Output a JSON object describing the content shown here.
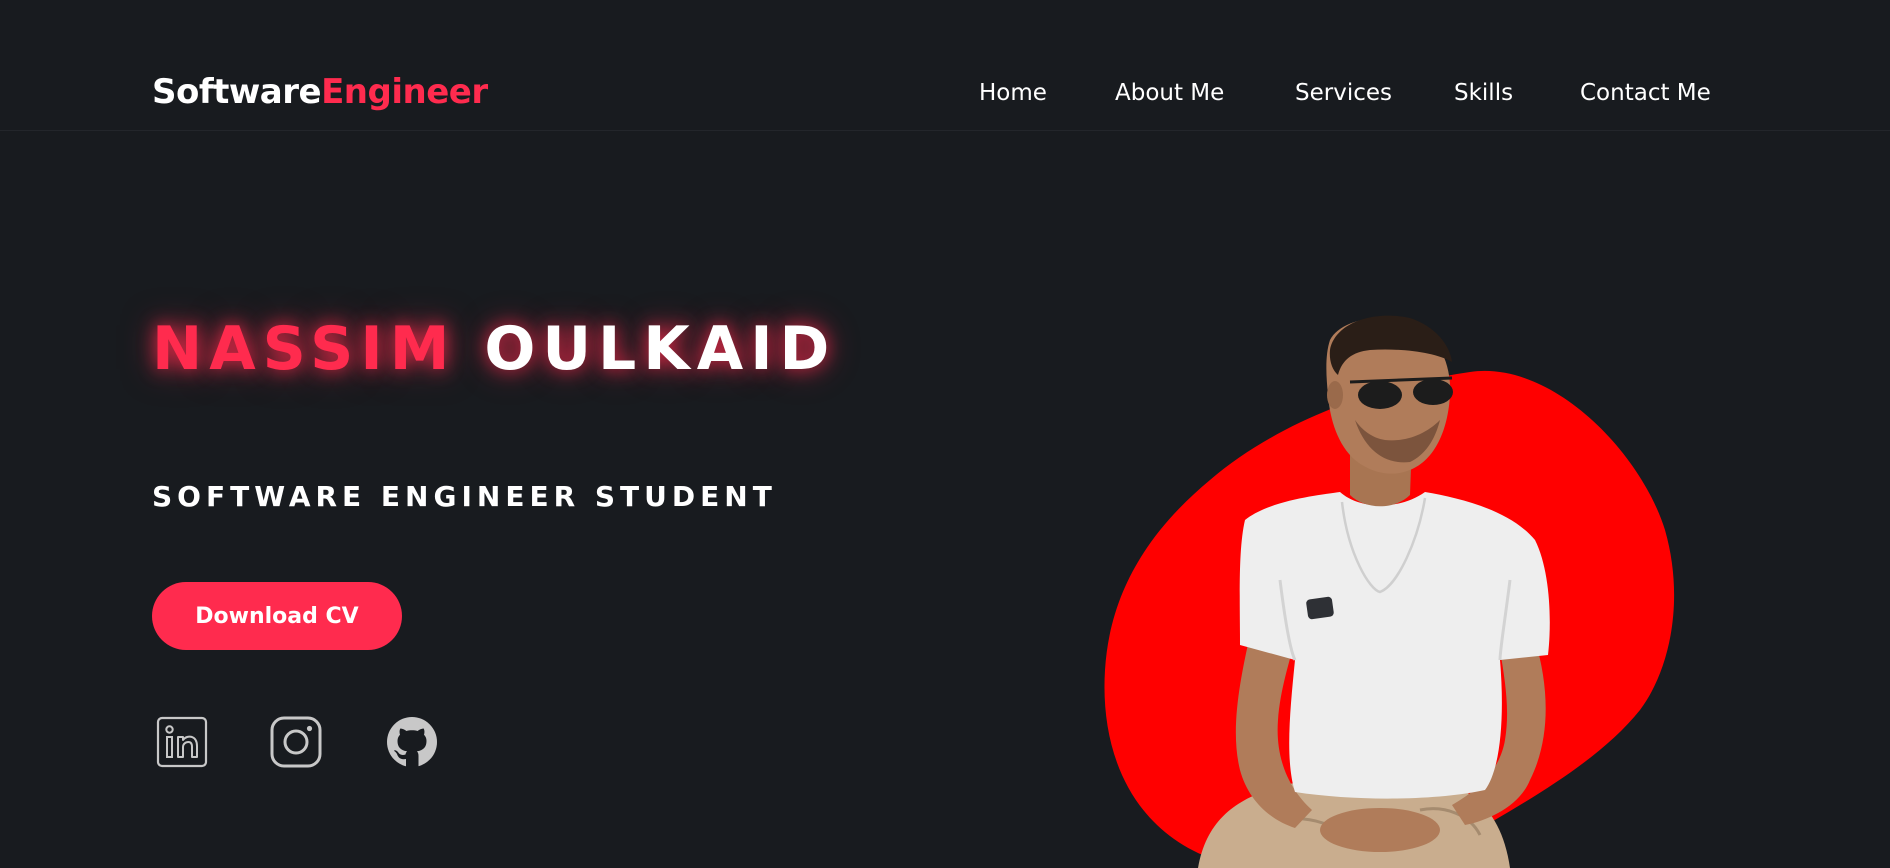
{
  "logo": {
    "part1": "Software",
    "part2": "Engineer"
  },
  "nav": {
    "items": [
      "Home",
      "About Me",
      "Services",
      "Skills",
      "Contact Me"
    ]
  },
  "hero": {
    "first_name": "NASSIM",
    "last_name": "OULKAID",
    "subtitle": "SOFTWARE ENGINEER STUDENT",
    "cta_label": "Download CV"
  },
  "social": {
    "icons": [
      "linkedin-icon",
      "instagram-icon",
      "github-icon"
    ]
  },
  "colors": {
    "background": "#181b1f",
    "accent": "#ff2b4e",
    "blob": "#ff0000",
    "icon": "#c8c8c8"
  }
}
